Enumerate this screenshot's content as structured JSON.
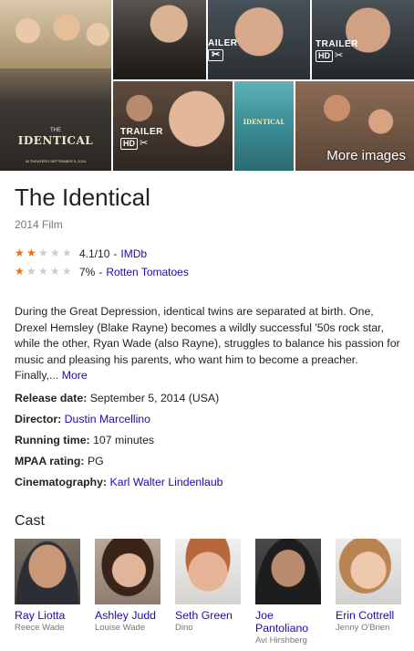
{
  "gallery": {
    "poster": {
      "the": "THE",
      "title": "IDENTICAL",
      "footer": "IN THEATERS SEPTEMBER 5, 2014"
    },
    "trailer_label_partial": "AILER",
    "trailer_label": "TRAILER",
    "hd_label": "HD",
    "scissors_icon": "✂",
    "mini_poster_title": "IDENTICAL",
    "more_images": "More images"
  },
  "entity": {
    "title": "The Identical",
    "subtitle": "2014 Film"
  },
  "ratings": [
    {
      "stars": 2,
      "score": "4.1/10",
      "source": "IMDb"
    },
    {
      "stars": 1,
      "score": "7%",
      "source": "Rotten Tomatoes"
    }
  ],
  "description": {
    "text": "During the Great Depression, identical twins are separated at birth. One, Drexel Hemsley (Blake Rayne) becomes a wildly successful '50s rock star, while the other, Ryan Wade (also Rayne), struggles to balance his passion for music and pleasing his parents, who want him to become a preacher. Finally,...",
    "more": "More"
  },
  "facts": {
    "release_label": "Release date:",
    "release_value": "September 5, 2014 (USA)",
    "director_label": "Director:",
    "director_value": "Dustin Marcellino",
    "runtime_label": "Running time:",
    "runtime_value": "107 minutes",
    "mpaa_label": "MPAA rating:",
    "mpaa_value": "PG",
    "cinematography_label": "Cinematography:",
    "cinematography_value": "Karl Walter Lindenlaub"
  },
  "cast": {
    "heading": "Cast",
    "members": [
      {
        "name": "Ray Liotta",
        "role": "Reece Wade"
      },
      {
        "name": "Ashley Judd",
        "role": "Louise Wade"
      },
      {
        "name": "Seth Green",
        "role": "Dino"
      },
      {
        "name": "Joe Pantoliano",
        "role": "Avi Hirshberg"
      },
      {
        "name": "Erin Cottrell",
        "role": "Jenny O'Brien"
      }
    ]
  },
  "colors": {
    "link": "#1a0dab",
    "star": "#e7711b",
    "muted": "#777777"
  }
}
